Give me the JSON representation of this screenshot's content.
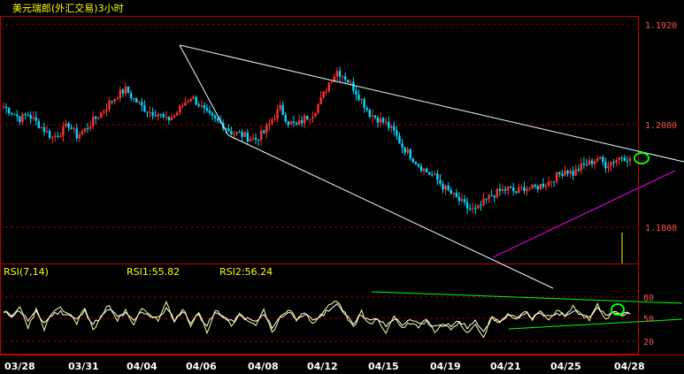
{
  "window": {
    "title": "美元瑞郎(外汇交易)3小时"
  },
  "colors": {
    "background": "#000000",
    "frame": "#c00000",
    "grid": "#8b0000",
    "up_candle": "#ff3030",
    "down_candle": "#00d8ff",
    "trendline": "#e0ffff",
    "support_line": "#c000c0",
    "rsi_line": "#ffffa0",
    "rsi2_line": "#ffffff",
    "rsi_trend": "#00ff00",
    "marker": "#00ff00",
    "title_text": "#ffff00",
    "label_text": "#ffff00",
    "axis_text": "#ff5050"
  },
  "price_axis": {
    "labels": [
      "1.1920",
      "1.2000",
      "1.1800"
    ]
  },
  "rsi_panel": {
    "name": "RSI(7,14)",
    "rsi1_label": "RSI1:55.82",
    "rsi2_label": "RSI2:56.24",
    "axis_labels": [
      "80",
      "50",
      "20"
    ]
  },
  "date_axis": {
    "labels": [
      "03/28",
      "03/31",
      "04/04",
      "04/06",
      "04/08",
      "04/12",
      "04/15",
      "04/19",
      "04/21",
      "04/25",
      "04/28"
    ]
  },
  "chart_data": {
    "type": "candlestick",
    "title": "美元瑞郎(外汇交易)3小时",
    "price_labels": [
      "1.1920",
      "1.2000",
      "1.1800"
    ],
    "price_range": [
      1.173,
      1.1935
    ],
    "x_labels": [
      "03/28",
      "03/31",
      "04/04",
      "04/06",
      "04/08",
      "04/12",
      "04/15",
      "04/19",
      "04/21",
      "04/25",
      "04/28"
    ],
    "close_path": [
      1.2035,
      1.2025,
      1.2012,
      1.202,
      1.2005,
      1.199,
      1.1975,
      1.1985,
      1.2,
      1.1978,
      1.199,
      1.2008,
      1.2022,
      1.2042,
      1.2058,
      1.2068,
      1.205,
      1.2035,
      1.2025,
      1.2022,
      1.2008,
      1.2018,
      1.2038,
      1.2055,
      1.204,
      1.202,
      1.2008,
      1.2,
      1.1985,
      1.1982,
      1.1975,
      1.1972,
      1.1985,
      1.201,
      1.2032,
      1.2005,
      1.1998,
      1.2012,
      1.2022,
      1.2048,
      1.2082,
      1.2105,
      1.2092,
      1.2072,
      1.2048,
      1.2022,
      1.2012,
      1.2002,
      1.1985,
      1.1958,
      1.194,
      1.1922,
      1.1908,
      1.1898,
      1.188,
      1.1865,
      1.1852,
      1.1838,
      1.1832,
      1.1848,
      1.1862,
      1.187,
      1.1875,
      1.1868,
      1.1878,
      1.1875,
      1.1882,
      1.1888,
      1.19,
      1.1912,
      1.1905,
      1.1918,
      1.1925,
      1.1935,
      1.1922,
      1.193,
      1.1938,
      1.1935
    ],
    "rsi": {
      "period_label": "RSI(7,14)",
      "rsi1": 55.82,
      "rsi2": 56.24,
      "levels": [
        80,
        50,
        20
      ],
      "range": [
        0,
        100
      ],
      "rsi1_path": [
        60,
        52,
        66,
        38,
        62,
        35,
        58,
        63,
        57,
        44,
        65,
        33,
        52,
        70,
        48,
        60,
        39,
        66,
        55,
        47,
        71,
        44,
        65,
        38,
        58,
        30,
        61,
        54,
        40,
        55,
        47,
        41,
        60,
        28,
        53,
        64,
        48,
        57,
        43,
        53,
        69,
        75,
        56,
        36,
        60,
        41,
        48,
        30,
        53,
        36,
        44,
        38,
        47,
        31,
        41,
        35,
        46,
        30,
        43,
        25,
        52,
        44,
        56,
        48,
        62,
        50,
        58,
        49,
        62,
        52,
        67,
        55,
        48,
        70,
        50,
        58,
        56,
        56
      ],
      "rsi2_path": [
        58,
        54,
        61,
        47,
        58,
        44,
        55,
        59,
        55,
        48,
        60,
        42,
        52,
        63,
        52,
        56,
        46,
        60,
        54,
        50,
        64,
        48,
        60,
        45,
        55,
        40,
        57,
        53,
        45,
        53,
        49,
        45,
        55,
        38,
        51,
        59,
        51,
        55,
        48,
        53,
        63,
        68,
        57,
        44,
        56,
        46,
        49,
        39,
        50,
        42,
        46,
        43,
        47,
        38,
        44,
        40,
        46,
        37,
        45,
        34,
        49,
        46,
        54,
        50,
        58,
        51,
        56,
        51,
        58,
        54,
        62,
        56,
        52,
        64,
        54,
        57,
        56,
        56
      ]
    }
  }
}
